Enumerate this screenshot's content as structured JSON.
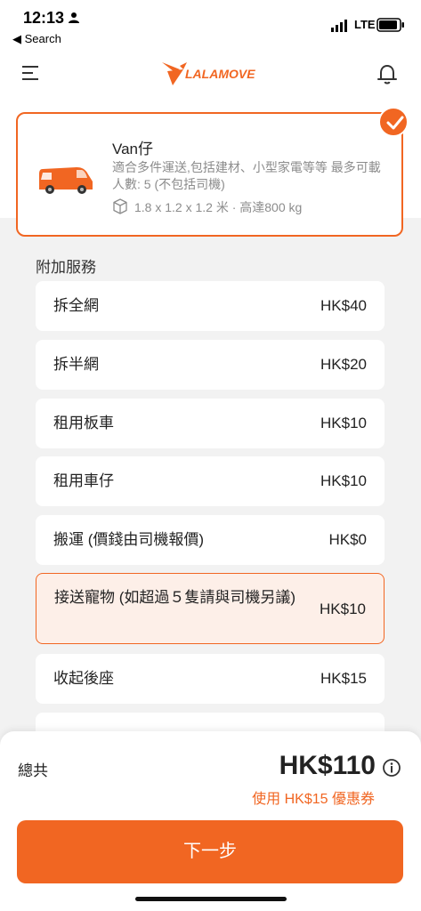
{
  "status_bar": {
    "time": "12:13",
    "back_label": "◀ Search",
    "network": "LTE"
  },
  "header": {
    "logo_text": "LALAMOVE",
    "brand_color": "#f16622"
  },
  "vehicle": {
    "name": "Van仔",
    "description": "適合多件運送,包括建材、小型家電等等 最多可載人數: 5 (不包括司機)",
    "dimensions": "1.8 x 1.2 x 1.2 米 · 高達800 kg",
    "selected": true
  },
  "services": {
    "title": "附加服務",
    "items": [
      {
        "label": "拆全網",
        "price": "HK$40"
      },
      {
        "label": "拆半網",
        "price": "HK$20"
      },
      {
        "label": "租用板車",
        "price": "HK$10"
      },
      {
        "label": "租用車仔",
        "price": "HK$10"
      },
      {
        "label": "搬運 (價錢由司機報價)",
        "price": "HK$0"
      },
      {
        "label": "接送寵物 (如超過５隻請與司機另議)",
        "price": "HK$10"
      },
      {
        "label": "收起後座",
        "price": "HK$15"
      }
    ]
  },
  "summary": {
    "total_label": "總共",
    "total_amount": "HK$110",
    "coupon_text": "使用 HK$15 優惠券",
    "next_label": "下一步"
  }
}
